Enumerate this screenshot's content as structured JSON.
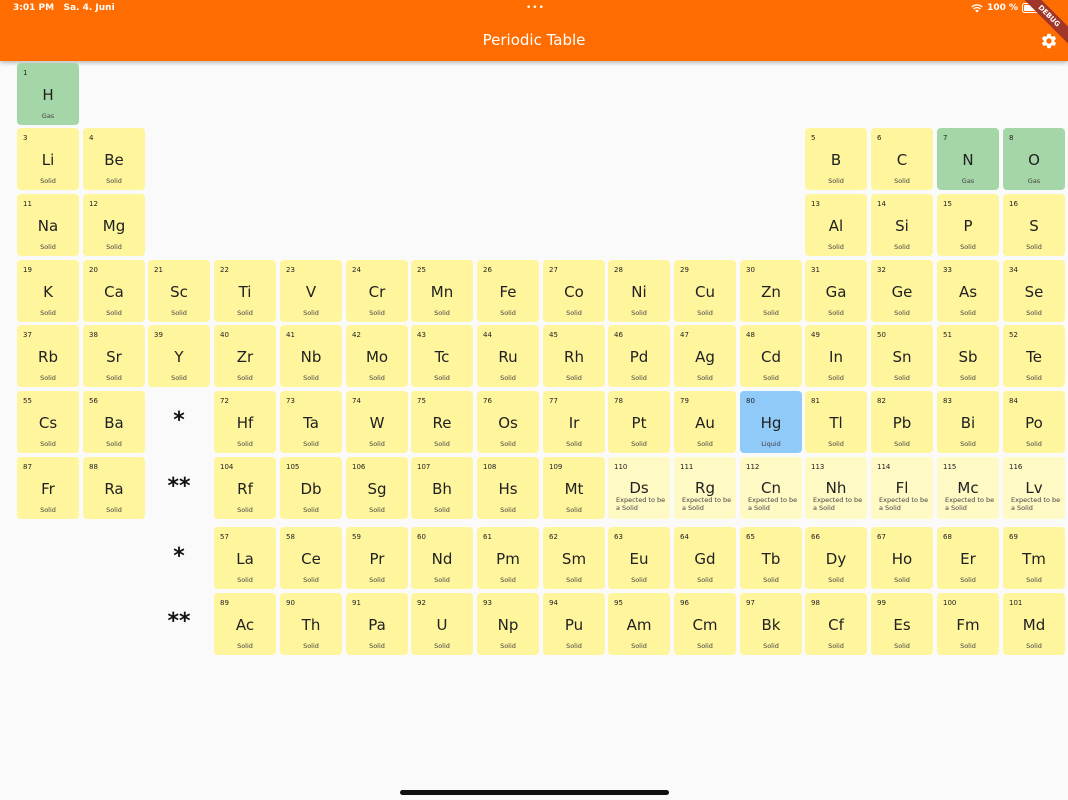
{
  "status_bar": {
    "time": "3:01 PM",
    "date": "Sa. 4. Juni",
    "battery": "100 %"
  },
  "app": {
    "title": "Periodic Table",
    "banner": "DEBUG"
  },
  "colors": {
    "appbar": "#ff6d00",
    "solid": "#fff59d",
    "gas": "#a5d6a7",
    "liquid": "#90caf9",
    "expected": "#fff9c4"
  },
  "series_markers": {
    "lanthanides": "*",
    "actinides": "**"
  },
  "elements": [
    {
      "n": "1",
      "s": "H",
      "st": "Gas",
      "c": "gas"
    },
    {
      "n": "3",
      "s": "Li",
      "st": "Solid",
      "c": "solid"
    },
    {
      "n": "4",
      "s": "Be",
      "st": "Solid",
      "c": "solid"
    },
    {
      "n": "5",
      "s": "B",
      "st": "Solid",
      "c": "solid"
    },
    {
      "n": "6",
      "s": "C",
      "st": "Solid",
      "c": "solid"
    },
    {
      "n": "7",
      "s": "N",
      "st": "Gas",
      "c": "gas"
    },
    {
      "n": "8",
      "s": "O",
      "st": "Gas",
      "c": "gas"
    },
    {
      "n": "11",
      "s": "Na",
      "st": "Solid",
      "c": "solid"
    },
    {
      "n": "12",
      "s": "Mg",
      "st": "Solid",
      "c": "solid"
    },
    {
      "n": "13",
      "s": "Al",
      "st": "Solid",
      "c": "solid"
    },
    {
      "n": "14",
      "s": "Si",
      "st": "Solid",
      "c": "solid"
    },
    {
      "n": "15",
      "s": "P",
      "st": "Solid",
      "c": "solid"
    },
    {
      "n": "16",
      "s": "S",
      "st": "Solid",
      "c": "solid"
    },
    {
      "n": "19",
      "s": "K",
      "st": "Solid",
      "c": "solid"
    },
    {
      "n": "20",
      "s": "Ca",
      "st": "Solid",
      "c": "solid"
    },
    {
      "n": "21",
      "s": "Sc",
      "st": "Solid",
      "c": "solid"
    },
    {
      "n": "22",
      "s": "Ti",
      "st": "Solid",
      "c": "solid"
    },
    {
      "n": "23",
      "s": "V",
      "st": "Solid",
      "c": "solid"
    },
    {
      "n": "24",
      "s": "Cr",
      "st": "Solid",
      "c": "solid"
    },
    {
      "n": "25",
      "s": "Mn",
      "st": "Solid",
      "c": "solid"
    },
    {
      "n": "26",
      "s": "Fe",
      "st": "Solid",
      "c": "solid"
    },
    {
      "n": "27",
      "s": "Co",
      "st": "Solid",
      "c": "solid"
    },
    {
      "n": "28",
      "s": "Ni",
      "st": "Solid",
      "c": "solid"
    },
    {
      "n": "29",
      "s": "Cu",
      "st": "Solid",
      "c": "solid"
    },
    {
      "n": "30",
      "s": "Zn",
      "st": "Solid",
      "c": "solid"
    },
    {
      "n": "31",
      "s": "Ga",
      "st": "Solid",
      "c": "solid"
    },
    {
      "n": "32",
      "s": "Ge",
      "st": "Solid",
      "c": "solid"
    },
    {
      "n": "33",
      "s": "As",
      "st": "Solid",
      "c": "solid"
    },
    {
      "n": "34",
      "s": "Se",
      "st": "Solid",
      "c": "solid"
    },
    {
      "n": "37",
      "s": "Rb",
      "st": "Solid",
      "c": "solid"
    },
    {
      "n": "38",
      "s": "Sr",
      "st": "Solid",
      "c": "solid"
    },
    {
      "n": "39",
      "s": "Y",
      "st": "Solid",
      "c": "solid"
    },
    {
      "n": "40",
      "s": "Zr",
      "st": "Solid",
      "c": "solid"
    },
    {
      "n": "41",
      "s": "Nb",
      "st": "Solid",
      "c": "solid"
    },
    {
      "n": "42",
      "s": "Mo",
      "st": "Solid",
      "c": "solid"
    },
    {
      "n": "43",
      "s": "Tc",
      "st": "Solid",
      "c": "solid"
    },
    {
      "n": "44",
      "s": "Ru",
      "st": "Solid",
      "c": "solid"
    },
    {
      "n": "45",
      "s": "Rh",
      "st": "Solid",
      "c": "solid"
    },
    {
      "n": "46",
      "s": "Pd",
      "st": "Solid",
      "c": "solid"
    },
    {
      "n": "47",
      "s": "Ag",
      "st": "Solid",
      "c": "solid"
    },
    {
      "n": "48",
      "s": "Cd",
      "st": "Solid",
      "c": "solid"
    },
    {
      "n": "49",
      "s": "In",
      "st": "Solid",
      "c": "solid"
    },
    {
      "n": "50",
      "s": "Sn",
      "st": "Solid",
      "c": "solid"
    },
    {
      "n": "51",
      "s": "Sb",
      "st": "Solid",
      "c": "solid"
    },
    {
      "n": "52",
      "s": "Te",
      "st": "Solid",
      "c": "solid"
    },
    {
      "n": "55",
      "s": "Cs",
      "st": "Solid",
      "c": "solid"
    },
    {
      "n": "56",
      "s": "Ba",
      "st": "Solid",
      "c": "solid"
    },
    {
      "n": "72",
      "s": "Hf",
      "st": "Solid",
      "c": "solid"
    },
    {
      "n": "73",
      "s": "Ta",
      "st": "Solid",
      "c": "solid"
    },
    {
      "n": "74",
      "s": "W",
      "st": "Solid",
      "c": "solid"
    },
    {
      "n": "75",
      "s": "Re",
      "st": "Solid",
      "c": "solid"
    },
    {
      "n": "76",
      "s": "Os",
      "st": "Solid",
      "c": "solid"
    },
    {
      "n": "77",
      "s": "Ir",
      "st": "Solid",
      "c": "solid"
    },
    {
      "n": "78",
      "s": "Pt",
      "st": "Solid",
      "c": "solid"
    },
    {
      "n": "79",
      "s": "Au",
      "st": "Solid",
      "c": "solid"
    },
    {
      "n": "80",
      "s": "Hg",
      "st": "Liquid",
      "c": "liquid"
    },
    {
      "n": "81",
      "s": "Tl",
      "st": "Solid",
      "c": "solid"
    },
    {
      "n": "82",
      "s": "Pb",
      "st": "Solid",
      "c": "solid"
    },
    {
      "n": "83",
      "s": "Bi",
      "st": "Solid",
      "c": "solid"
    },
    {
      "n": "84",
      "s": "Po",
      "st": "Solid",
      "c": "solid"
    },
    {
      "n": "87",
      "s": "Fr",
      "st": "Solid",
      "c": "solid"
    },
    {
      "n": "88",
      "s": "Ra",
      "st": "Solid",
      "c": "solid"
    },
    {
      "n": "104",
      "s": "Rf",
      "st": "Solid",
      "c": "solid"
    },
    {
      "n": "105",
      "s": "Db",
      "st": "Solid",
      "c": "solid"
    },
    {
      "n": "106",
      "s": "Sg",
      "st": "Solid",
      "c": "solid"
    },
    {
      "n": "107",
      "s": "Bh",
      "st": "Solid",
      "c": "solid"
    },
    {
      "n": "108",
      "s": "Hs",
      "st": "Solid",
      "c": "solid"
    },
    {
      "n": "109",
      "s": "Mt",
      "st": "Solid",
      "c": "solid"
    },
    {
      "n": "110",
      "s": "Ds",
      "st": "Expected to be a Solid",
      "c": "expected"
    },
    {
      "n": "111",
      "s": "Rg",
      "st": "Expected to be a Solid",
      "c": "expected"
    },
    {
      "n": "112",
      "s": "Cn",
      "st": "Expected to be a Solid",
      "c": "expected"
    },
    {
      "n": "113",
      "s": "Nh",
      "st": "Expected to be a Solid",
      "c": "expected"
    },
    {
      "n": "114",
      "s": "Fl",
      "st": "Expected to be a Solid",
      "c": "expected"
    },
    {
      "n": "115",
      "s": "Mc",
      "st": "Expected to be a Solid",
      "c": "expected"
    },
    {
      "n": "116",
      "s": "Lv",
      "st": "Expected to be a Solid",
      "c": "expected"
    },
    {
      "n": "57",
      "s": "La",
      "st": "Solid",
      "c": "solid"
    },
    {
      "n": "58",
      "s": "Ce",
      "st": "Solid",
      "c": "solid"
    },
    {
      "n": "59",
      "s": "Pr",
      "st": "Solid",
      "c": "solid"
    },
    {
      "n": "60",
      "s": "Nd",
      "st": "Solid",
      "c": "solid"
    },
    {
      "n": "61",
      "s": "Pm",
      "st": "Solid",
      "c": "solid"
    },
    {
      "n": "62",
      "s": "Sm",
      "st": "Solid",
      "c": "solid"
    },
    {
      "n": "63",
      "s": "Eu",
      "st": "Solid",
      "c": "solid"
    },
    {
      "n": "64",
      "s": "Gd",
      "st": "Solid",
      "c": "solid"
    },
    {
      "n": "65",
      "s": "Tb",
      "st": "Solid",
      "c": "solid"
    },
    {
      "n": "66",
      "s": "Dy",
      "st": "Solid",
      "c": "solid"
    },
    {
      "n": "67",
      "s": "Ho",
      "st": "Solid",
      "c": "solid"
    },
    {
      "n": "68",
      "s": "Er",
      "st": "Solid",
      "c": "solid"
    },
    {
      "n": "69",
      "s": "Tm",
      "st": "Solid",
      "c": "solid"
    },
    {
      "n": "89",
      "s": "Ac",
      "st": "Solid",
      "c": "solid"
    },
    {
      "n": "90",
      "s": "Th",
      "st": "Solid",
      "c": "solid"
    },
    {
      "n": "91",
      "s": "Pa",
      "st": "Solid",
      "c": "solid"
    },
    {
      "n": "92",
      "s": "U",
      "st": "Solid",
      "c": "solid"
    },
    {
      "n": "93",
      "s": "Np",
      "st": "Solid",
      "c": "solid"
    },
    {
      "n": "94",
      "s": "Pu",
      "st": "Solid",
      "c": "solid"
    },
    {
      "n": "95",
      "s": "Am",
      "st": "Solid",
      "c": "solid"
    },
    {
      "n": "96",
      "s": "Cm",
      "st": "Solid",
      "c": "solid"
    },
    {
      "n": "97",
      "s": "Bk",
      "st": "Solid",
      "c": "solid"
    },
    {
      "n": "98",
      "s": "Cf",
      "st": "Solid",
      "c": "solid"
    },
    {
      "n": "99",
      "s": "Es",
      "st": "Solid",
      "c": "solid"
    },
    {
      "n": "100",
      "s": "Fm",
      "st": "Solid",
      "c": "solid"
    },
    {
      "n": "101",
      "s": "Md",
      "st": "Solid",
      "c": "solid"
    }
  ]
}
